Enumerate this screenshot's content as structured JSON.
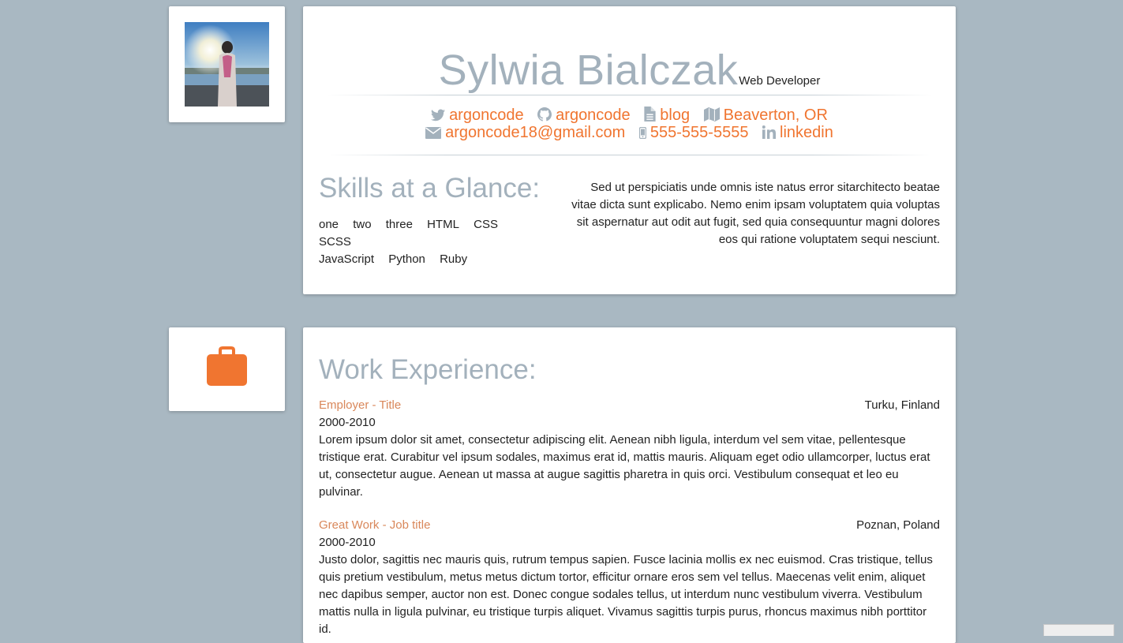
{
  "profile": {
    "name": "Sylwia Bialczak",
    "role": "Web Developer",
    "photo_icon": "profile-photo"
  },
  "contacts": [
    {
      "icon": "twitter-icon",
      "label": "argoncode"
    },
    {
      "icon": "github-icon",
      "label": "argoncode"
    },
    {
      "icon": "document-icon",
      "label": "blog"
    },
    {
      "icon": "map-icon",
      "label": "Beaverton, OR"
    },
    {
      "icon": "envelope-icon",
      "label": "argoncode18@gmail.com"
    },
    {
      "icon": "mobile-icon",
      "label": "555-555-5555"
    },
    {
      "icon": "linkedin-icon",
      "label": "linkedin"
    }
  ],
  "skills": {
    "title": "Skills at a Glance:",
    "items": [
      "one",
      "two",
      "three",
      "HTML",
      "CSS",
      "SCSS",
      "JavaScript",
      "Python",
      "Ruby"
    ]
  },
  "summary": "Sed ut perspiciatis unde omnis iste natus error sitarchitecto beatae vitae dicta sunt explicabo. Nemo enim ipsam voluptatem quia voluptas sit aspernatur aut odit aut fugit, sed quia consequuntur magni dolores eos qui ratione voluptatem sequi nesciunt.",
  "work": {
    "icon": "briefcase-icon",
    "title": "Work Experience:",
    "jobs": [
      {
        "title": "Employer - Title",
        "location": "Turku, Finland",
        "dates": "2000-2010",
        "description": "Lorem ipsum dolor sit amet, consectetur adipiscing elit. Aenean nibh ligula, interdum vel sem vitae, pellentesque tristique erat. Curabitur vel ipsum sodales, maximus erat id, mattis mauris. Aliquam eget odio ullamcorper, luctus erat ut, consectetur augue. Aenean ut massa at augue sagittis pharetra in quis orci. Vestibulum consequat et leo eu pulvinar."
      },
      {
        "title": "Great Work - Job title",
        "location": "Poznan, Poland",
        "dates": "2000-2010",
        "description": "Justo dolor, sagittis nec mauris quis, rutrum tempus sapien. Fusce lacinia mollis ex nec euismod. Cras tristique, tellus quis pretium vestibulum, metus metus dictum tortor, efficitur ornare eros sem vel tellus. Maecenas velit enim, aliquet nec dapibus semper, auctor non est. Donec congue sodales tellus, ut interdum nunc vestibulum viverra. Vestibulum mattis nulla in ligula pulvinar, eu tristique turpis aliquet. Vivamus sagittis turpis purus, rhoncus maximus nibh porttitor id."
      }
    ]
  },
  "colors": {
    "background": "#a9b8c2",
    "accent": "#f07530",
    "heading": "#a3b1bc",
    "job_title": "#d9875a"
  }
}
